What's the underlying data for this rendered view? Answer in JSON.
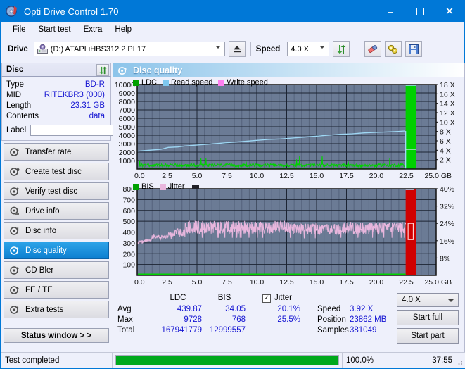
{
  "window": {
    "title": "Opti Drive Control 1.70",
    "icon": "disc-icon",
    "minimize": "–",
    "maximize": "❑",
    "close": "✕",
    "titlebar_color": "#0078d7"
  },
  "menu": {
    "items": [
      "File",
      "Start test",
      "Extra",
      "Help"
    ]
  },
  "toolbar": {
    "drive_label": "Drive",
    "drive_value": "(D:)   ATAPI iHBS312   2 PL17",
    "eject_icon": "eject-icon",
    "speed_label": "Speed",
    "speed_value": "4.0 X",
    "refresh_icon": "refresh-icon",
    "eraser_icon": "eraser-icon",
    "tools_icon": "tools-icon",
    "save_icon": "save-disk-icon"
  },
  "sidebar": {
    "panel_title": "Disc",
    "panel_button_icon": "refresh-icon",
    "info": [
      {
        "key": "Type",
        "value": "BD-R"
      },
      {
        "key": "MID",
        "value": "RITEKBR3 (000)"
      },
      {
        "key": "Length",
        "value": "23.31 GB"
      },
      {
        "key": "Contents",
        "value": "data"
      }
    ],
    "label_field": {
      "label": "Label",
      "value": "",
      "placeholder": "",
      "button_icon": "disc-icon"
    },
    "nav": [
      {
        "label": "Transfer rate",
        "icon": "disc-test-icon",
        "active": false
      },
      {
        "label": "Create test disc",
        "icon": "disc-burn-icon",
        "active": false
      },
      {
        "label": "Verify test disc",
        "icon": "disc-verify-icon",
        "active": false
      },
      {
        "label": "Drive info",
        "icon": "drive-info-icon",
        "active": false
      },
      {
        "label": "Disc info",
        "icon": "disc-info-icon",
        "active": false
      },
      {
        "label": "Disc quality",
        "icon": "disc-quality-icon",
        "active": true
      },
      {
        "label": "CD Bler",
        "icon": "disc-bler-icon",
        "active": false
      },
      {
        "label": "FE / TE",
        "icon": "disc-fete-icon",
        "active": false
      },
      {
        "label": "Extra tests",
        "icon": "disc-extra-icon",
        "active": false
      }
    ],
    "status_window_button": "Status window > >"
  },
  "main": {
    "header": {
      "title": "Disc quality",
      "icon": "disc-quality-icon"
    }
  },
  "chart_data": [
    {
      "id": "top",
      "type": "line",
      "title": "",
      "xlabel": "GB",
      "ylabel": "",
      "grid": true,
      "legend_position": "top-left",
      "legend": [
        {
          "name": "LDC",
          "color": "#00a000"
        },
        {
          "name": "Read speed",
          "color": "#7ec8f0"
        },
        {
          "name": "Write speed",
          "color": "#ff7ff0"
        }
      ],
      "x": [
        0.0,
        2.5,
        5.0,
        7.5,
        10.0,
        12.5,
        15.0,
        17.5,
        20.0,
        22.5,
        25.0
      ],
      "xlim": [
        0.0,
        25.0
      ],
      "xticklabels": [
        "0.0",
        "2.5",
        "5.0",
        "7.5",
        "10.0",
        "12.5",
        "15.0",
        "17.5",
        "20.0",
        "22.5",
        "25.0 GB"
      ],
      "ylim": [
        0,
        10000
      ],
      "yticklabels": [
        "10000",
        "9000",
        "8000",
        "7000",
        "6000",
        "5000",
        "4000",
        "3000",
        "2000",
        "1000"
      ],
      "y2lim": [
        0,
        18
      ],
      "y2ticklabels": [
        "18 X",
        "16 X",
        "14 X",
        "12 X",
        "10 X",
        "8 X",
        "6 X",
        "4 X",
        "2 X"
      ],
      "series": [
        {
          "name": "Read speed",
          "axis": "y2",
          "color": "#7ec8f0",
          "points": [
            [
              0.0,
              3.8
            ],
            [
              1.0,
              4.0
            ],
            [
              2.0,
              4.2
            ],
            [
              2.6,
              4.6
            ],
            [
              3.4,
              4.7
            ],
            [
              4.0,
              4.9
            ],
            [
              5.0,
              5.1
            ],
            [
              6.0,
              5.3
            ],
            [
              7.0,
              5.5
            ],
            [
              8.0,
              5.7
            ],
            [
              9.0,
              5.9
            ],
            [
              10.0,
              6.1
            ],
            [
              11.0,
              6.3
            ],
            [
              12.0,
              6.4
            ],
            [
              13.0,
              6.6
            ],
            [
              14.0,
              6.8
            ],
            [
              15.0,
              7.0
            ],
            [
              16.0,
              7.2
            ],
            [
              17.0,
              7.4
            ],
            [
              18.0,
              7.5
            ],
            [
              19.0,
              7.7
            ],
            [
              20.0,
              7.8
            ],
            [
              21.0,
              7.9
            ],
            [
              21.8,
              8.0
            ],
            [
              22.4,
              8.1
            ]
          ]
        },
        {
          "name": "LDC",
          "axis": "y",
          "color": "#00c000",
          "note": "dense low-level noise band near baseline, avg ~440, occasional spikes to ~1000"
        }
      ],
      "highlight_region": {
        "x0": 22.45,
        "x1": 23.35,
        "color": "#00d000",
        "label": "unscanned/remaining region"
      }
    },
    {
      "id": "bottom",
      "type": "line",
      "title": "",
      "xlabel": "GB",
      "grid": true,
      "legend_position": "top-left",
      "legend": [
        {
          "name": "BIS",
          "color": "#00a000"
        },
        {
          "name": "Jitter",
          "color": "#e8b6dd"
        }
      ],
      "xlim": [
        0.0,
        25.0
      ],
      "xticklabels": [
        "0.0",
        "2.5",
        "5.0",
        "7.5",
        "10.0",
        "12.5",
        "15.0",
        "17.5",
        "20.0",
        "22.5",
        "25.0 GB"
      ],
      "ylim": [
        0,
        800
      ],
      "yticklabels": [
        "800",
        "700",
        "600",
        "500",
        "400",
        "300",
        "200",
        "100"
      ],
      "y2lim": [
        0,
        40
      ],
      "y2ticklabels": [
        "40%",
        "32%",
        "24%",
        "16%",
        "8%"
      ],
      "series": [
        {
          "name": "Jitter",
          "axis": "y2",
          "color": "#e8b6dd",
          "note": "noisy band rising from ~16% at 0 GB to ~20-25% across disc, peaks ~25.5%"
        },
        {
          "name": "BIS",
          "axis": "y",
          "color": "#00c000",
          "note": "flat near zero baseline, avg 34"
        }
      ],
      "highlight_region": {
        "x0": 22.45,
        "x1": 23.35,
        "color": "#d00000",
        "label": "unscanned/remaining region"
      }
    }
  ],
  "stats": {
    "col_headers": [
      "LDC",
      "BIS"
    ],
    "rows": [
      {
        "label": "Avg",
        "ldc": "439.87",
        "bis": "34.05"
      },
      {
        "label": "Max",
        "ldc": "9728",
        "bis": "768"
      },
      {
        "label": "Total",
        "ldc": "167941779",
        "bis": "12999557"
      }
    ],
    "jitter": {
      "checkbox_label": "Jitter",
      "checked": true,
      "check_glyph": "✓",
      "avg": "20.1%",
      "max": "25.5%"
    },
    "readouts": [
      {
        "label": "Speed",
        "value": "3.92 X"
      },
      {
        "label": "Position",
        "value": "23862 MB"
      },
      {
        "label": "Samples",
        "value": "381049"
      }
    ],
    "speed_select": "4.0 X",
    "start_full_button": "Start full",
    "start_part_button": "Start part"
  },
  "statusbar": {
    "message": "Test completed",
    "progress_percent": 100.0,
    "progress_text": "100.0%",
    "elapsed": "37:55",
    "progress_color": "#00a81c"
  }
}
